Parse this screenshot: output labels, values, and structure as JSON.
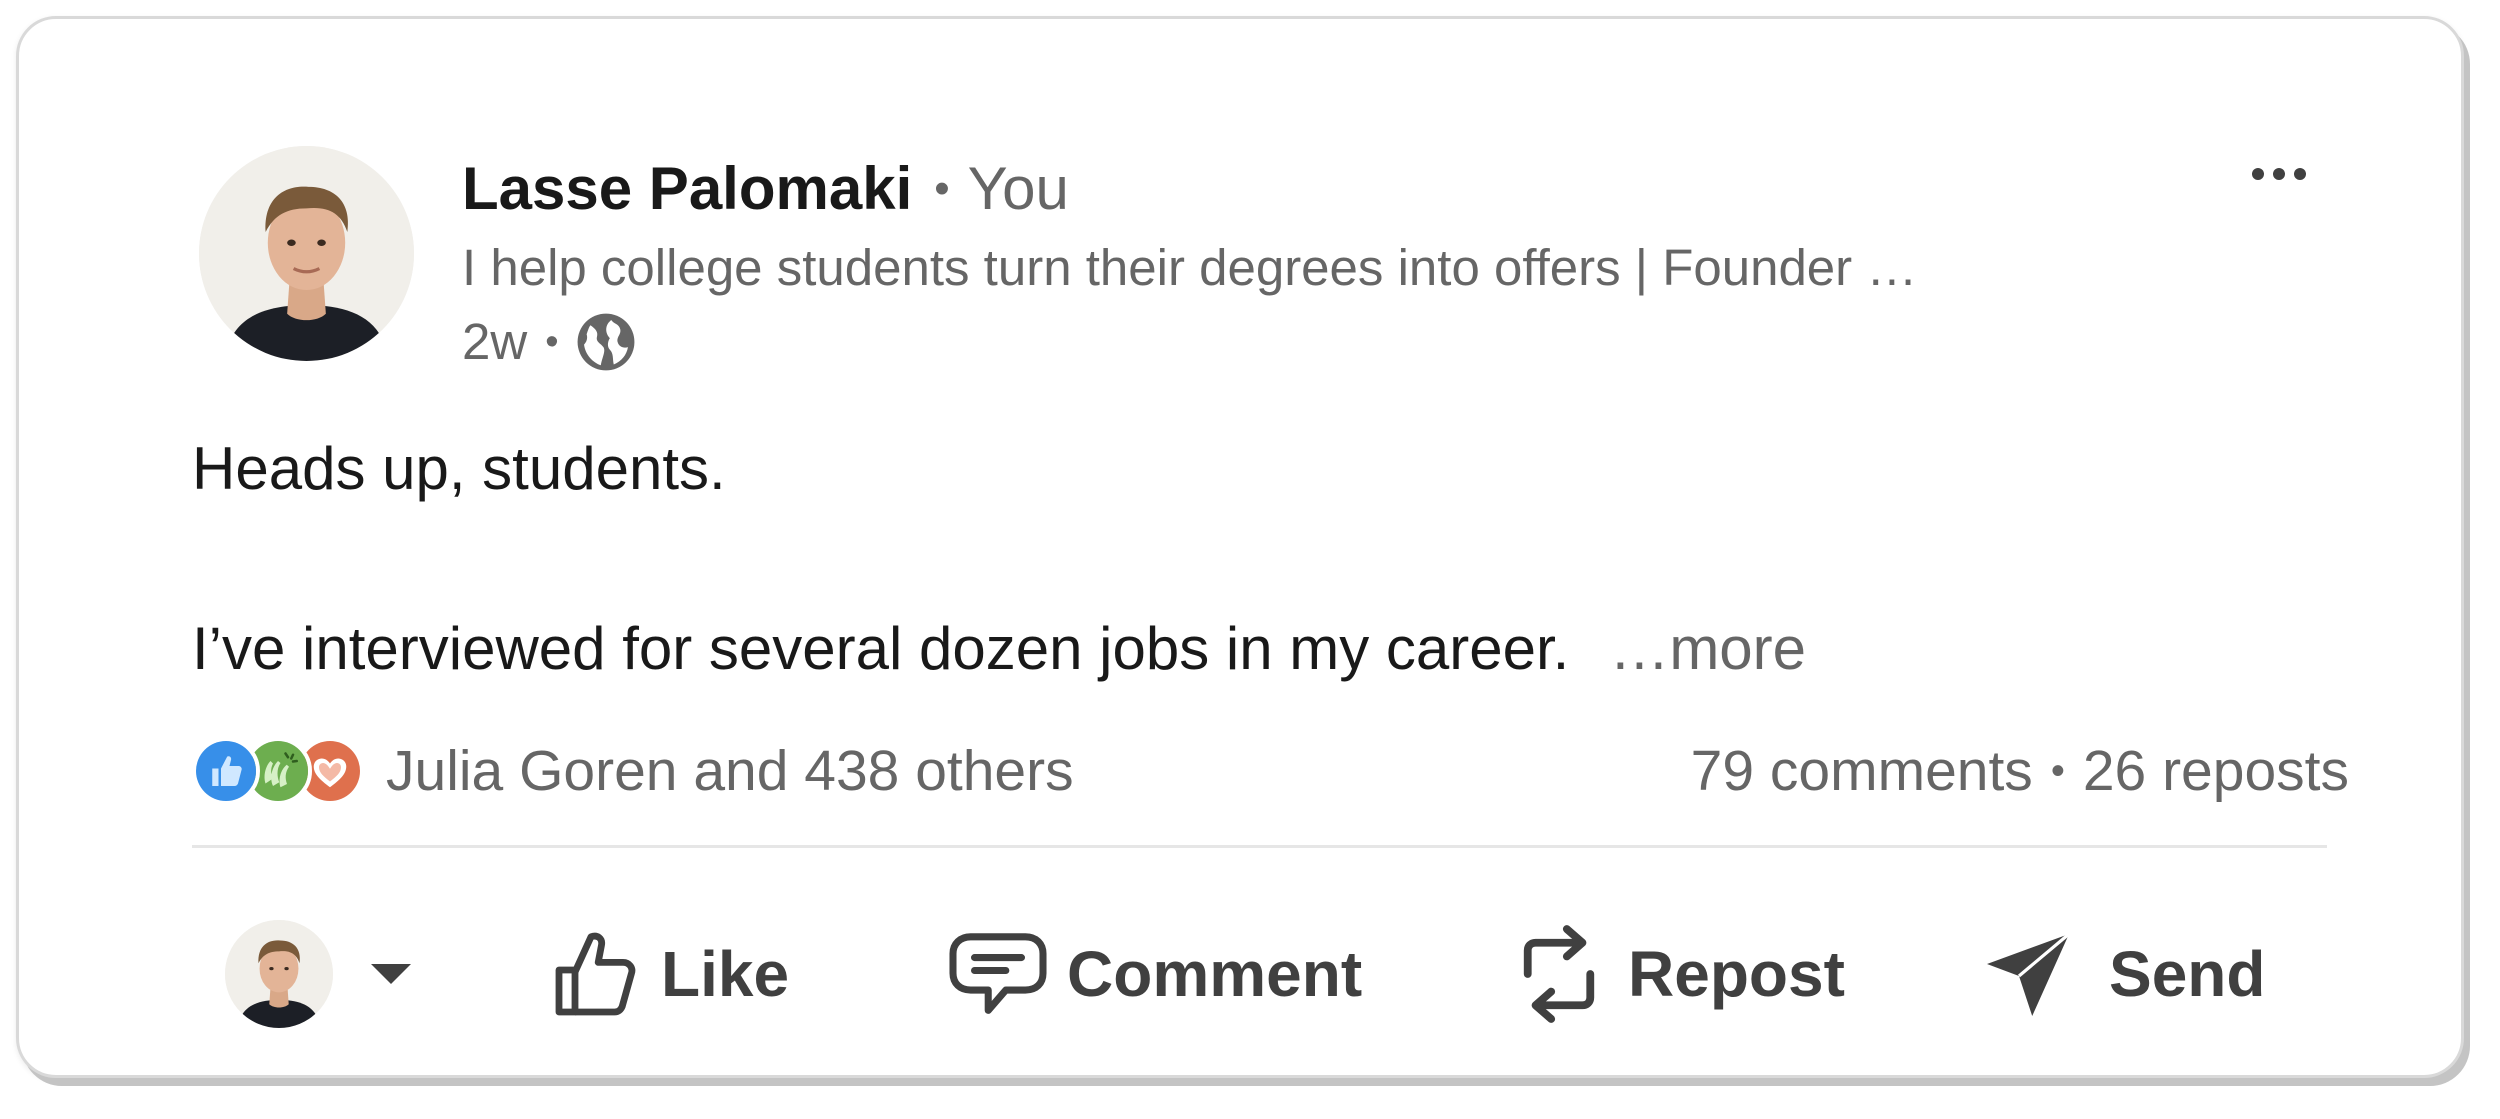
{
  "post": {
    "author": {
      "name": "Lasse Palomaki",
      "relation": "You",
      "headline": "I help college students turn their degrees into offers | Founder …",
      "time": "2w"
    },
    "body": {
      "line1": "Heads up, students.",
      "line2": "I’ve interviewed for several dozen jobs in my career.",
      "more_label": "…more"
    },
    "social": {
      "reactions_text": "Julia Goren and 438 others",
      "comments": "79 comments",
      "reposts": "26 reposts",
      "reaction_icons": [
        "like-icon",
        "celebrate-icon",
        "love-icon"
      ]
    },
    "actions": {
      "like": "Like",
      "comment": "Comment",
      "repost": "Repost",
      "send": "Send"
    }
  },
  "colors": {
    "text_primary": "#191919",
    "text_secondary": "#666666",
    "action_text": "#404040",
    "like_blue": "#378fe9",
    "celebrate_green": "#44712e",
    "love_orange": "#df704d"
  }
}
